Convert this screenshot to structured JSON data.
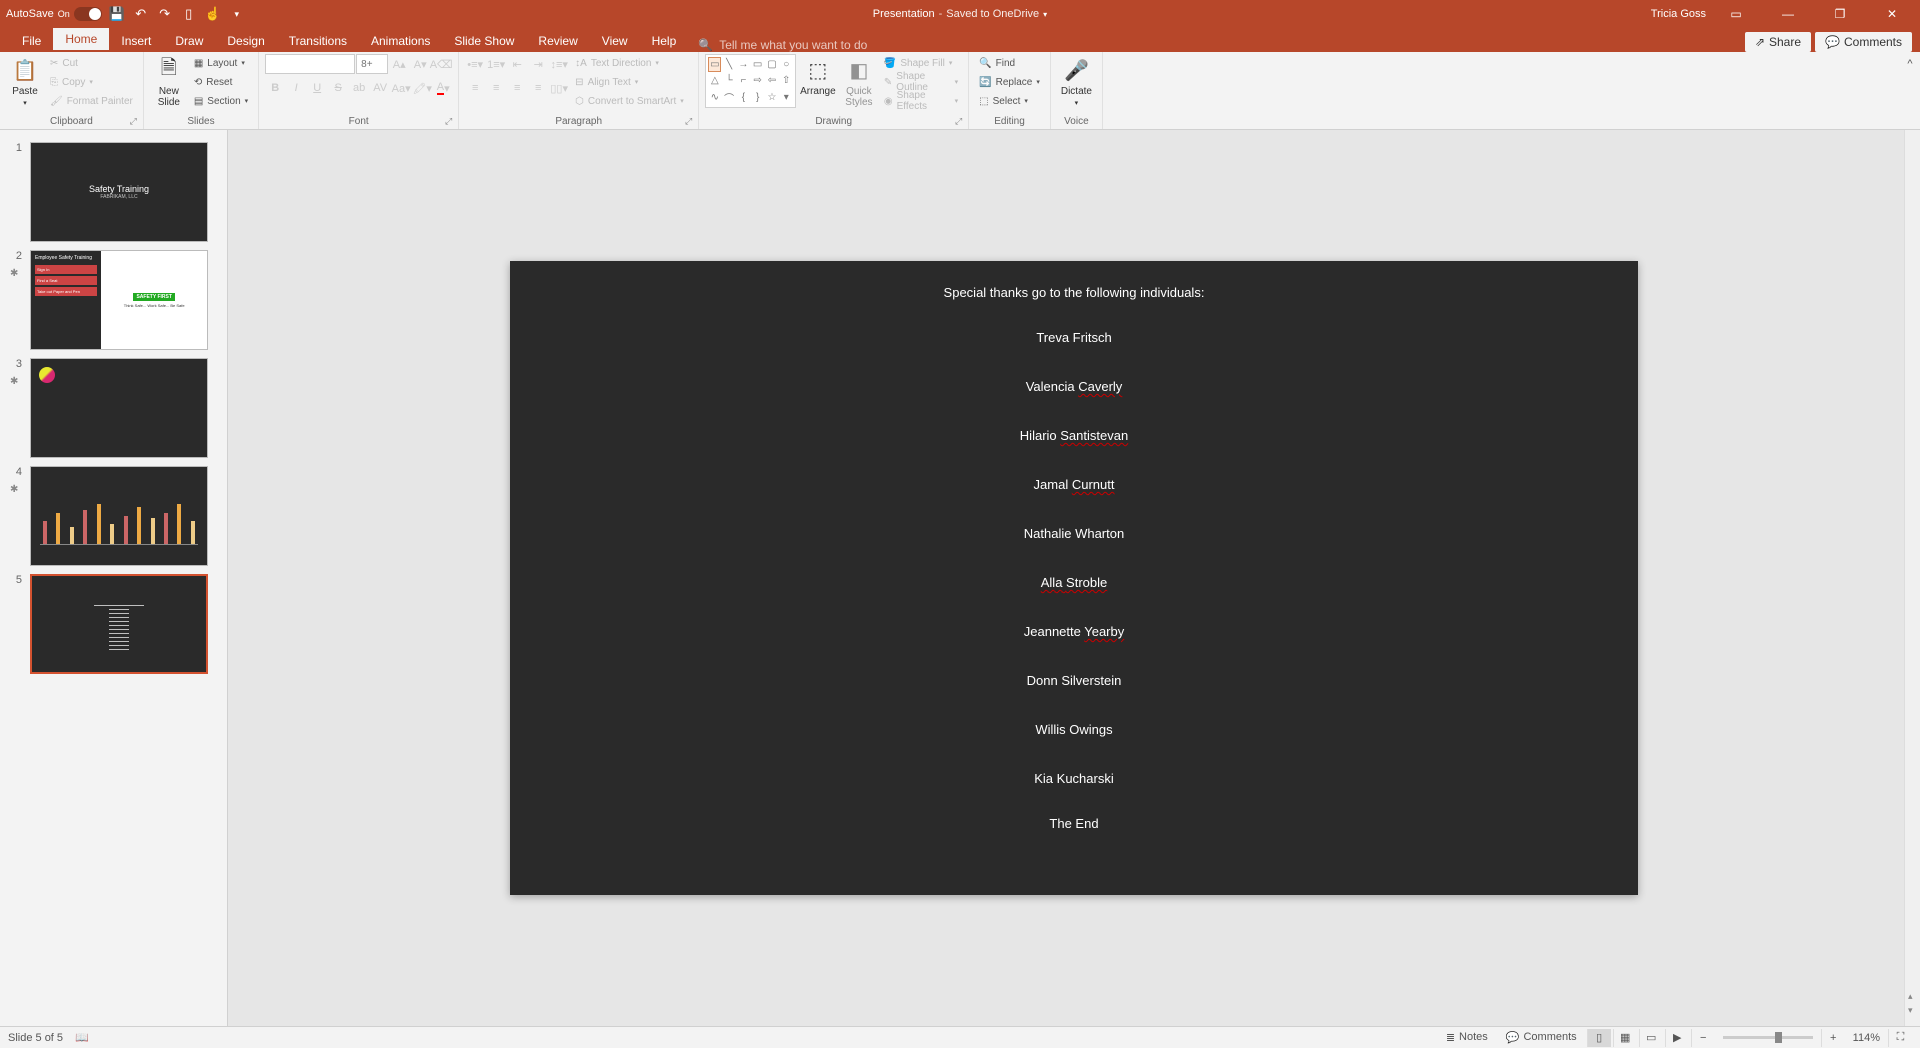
{
  "title_bar": {
    "autosave_label": "AutoSave",
    "autosave_state": "On",
    "doc_title": "Presentation",
    "save_status": "Saved to OneDrive",
    "user_name": "Tricia Goss"
  },
  "tabs": {
    "file": "File",
    "home": "Home",
    "insert": "Insert",
    "draw": "Draw",
    "design": "Design",
    "transitions": "Transitions",
    "animations": "Animations",
    "slideshow": "Slide Show",
    "review": "Review",
    "view": "View",
    "help": "Help",
    "tell_me_placeholder": "Tell me what you want to do",
    "share": "Share",
    "comments": "Comments"
  },
  "ribbon": {
    "clipboard": {
      "label": "Clipboard",
      "paste": "Paste",
      "cut": "Cut",
      "copy": "Copy",
      "format_painter": "Format Painter"
    },
    "slides": {
      "label": "Slides",
      "new_slide": "New\nSlide",
      "layout": "Layout",
      "reset": "Reset",
      "section": "Section"
    },
    "font": {
      "label": "Font",
      "size_placeholder": "8+"
    },
    "paragraph": {
      "label": "Paragraph",
      "text_direction": "Text Direction",
      "align_text": "Align Text",
      "smartart": "Convert to SmartArt"
    },
    "drawing": {
      "label": "Drawing",
      "arrange": "Arrange",
      "quick_styles": "Quick\nStyles",
      "shape_fill": "Shape Fill",
      "shape_outline": "Shape Outline",
      "shape_effects": "Shape Effects"
    },
    "editing": {
      "label": "Editing",
      "find": "Find",
      "replace": "Replace",
      "select": "Select"
    },
    "voice": {
      "label": "Voice",
      "dictate": "Dictate"
    }
  },
  "thumbnails": {
    "t1_title": "Safety Training",
    "t1_sub": "FABRIKAM, LLC",
    "t2_head": "Employee Safety Training",
    "t2_signin": "Sign In",
    "t2_seat": "Find a Seat",
    "t2_paper": "Take out Paper and Pen",
    "t2_safety": "SAFETY FIRST",
    "t2_think": "Think Safe... Work Safe... Be Safe"
  },
  "slide": {
    "heading": "Special thanks go to the following individuals:",
    "names": [
      {
        "first": "Treva",
        "last": "Fritsch",
        "err": false
      },
      {
        "first": "Valencia",
        "last": "Caverly",
        "err": true
      },
      {
        "first": "Hilario",
        "last": "Santistevan",
        "err": true
      },
      {
        "first": "Jamal",
        "last": "Curnutt",
        "err": true
      },
      {
        "first": "Nathalie",
        "last": "Wharton",
        "err": false
      },
      {
        "first": "Alla",
        "last": "Stroble",
        "err": true,
        "err_first": true
      },
      {
        "first": "Jeannette",
        "last": "Yearby",
        "err": true
      },
      {
        "first": "Donn",
        "last": "Silverstein",
        "err": false
      },
      {
        "first": "Willis",
        "last": "Owings",
        "err": false
      },
      {
        "first": "Kia",
        "last": "Kucharski",
        "err": false
      }
    ],
    "end": "The End"
  },
  "status": {
    "slide_indicator": "Slide 5 of 5",
    "notes": "Notes",
    "comments": "Comments",
    "zoom": "114%"
  },
  "chart_data": {
    "type": "bar",
    "note": "Thumbnail 4 shows a grouped bar chart mockup; exact values not legible at thumbnail resolution."
  }
}
